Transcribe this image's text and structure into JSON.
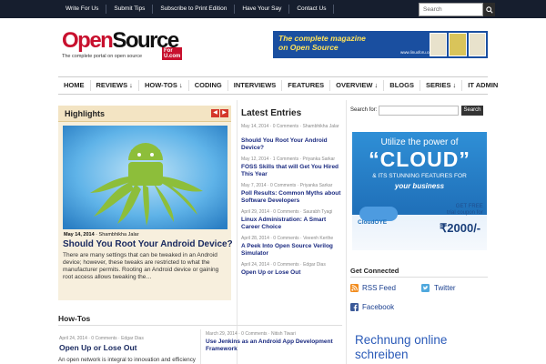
{
  "topnav": [
    "Write For Us",
    "Submit Tips",
    "Subscribe to Print Edition",
    "Have Your Say",
    "Contact Us"
  ],
  "search_top": {
    "placeholder": "Search"
  },
  "logo": {
    "open": "Open",
    "source": "Source",
    "foru": "For U.com",
    "tagline": "The complete portal on open source"
  },
  "banner": {
    "line1": "The complete magazine",
    "line2": "on Open Source",
    "url": "www.linuxforu.com"
  },
  "mainnav": [
    "HOME",
    "REVIEWS ↓",
    "HOW-TOS ↓",
    "CODING",
    "INTERVIEWS",
    "FEATURES",
    "OVERVIEW ↓",
    "BLOGS",
    "SERIES ↓",
    "IT ADMIN"
  ],
  "highlights": {
    "title": "Highlights",
    "date": "May 14, 2014",
    "author": "Shambhikha Jalar",
    "headline": "Should You Root Your Android Device?",
    "excerpt": "There are many settings that can be tweaked in an Android device; however, these tweaks are restricted to what the manufacturer permits. Rooting an Android device or gaining root access allows tweaking the…"
  },
  "latest": {
    "title": "Latest Entries",
    "items": [
      {
        "meta": "May 14, 2014 · 0 Comments · Shambhikha Jalar",
        "title": "Should You Root Your Android Device?"
      },
      {
        "meta": "May 12, 2014 · 1 Comments · Priyanka Sarkar",
        "title": "FOSS Skills that will Get You Hired This Year"
      },
      {
        "meta": "May 7, 2014 · 0 Comments · Priyanka Sarkar",
        "title": "Poll Results: Common Myths about Software Developers"
      },
      {
        "meta": "April 29, 2014 · 0 Comments · Saurabh Tyagi",
        "title": "Linux Administration: A Smart Career Choice"
      },
      {
        "meta": "April 28, 2014 · 0 Comments · Veeenh Kerthe",
        "title": "A Peek Into Open Source Verilog Simulator"
      },
      {
        "meta": "April 24, 2014 · 0 Comments · Edgar Dias",
        "title": "Open Up or Lose Out"
      }
    ]
  },
  "sidebar_search": {
    "label": "Search for:",
    "button": "Search"
  },
  "cloud_ad": {
    "line1": "Utilize the power of",
    "line2": "“CLOUD”",
    "line3": "& ITS STUNNING FEATURES FOR",
    "line4": "your business",
    "brand": "CloudOYE",
    "free1": "GET FREE",
    "free2": "trial coupon for",
    "price": "₹2000/-"
  },
  "get_connected": {
    "title": "Get Connected",
    "rss": "RSS Feed",
    "twitter": "Twitter",
    "facebook": "Facebook"
  },
  "rechnung": {
    "line1": "Rechnung online",
    "line2": "schreiben"
  },
  "howtos": {
    "title": "How-Tos",
    "left_meta": "April 24, 2014 · 0 Comments · Edgar Dias",
    "left_title": "Open Up or Lose Out",
    "left_excerpt": "An open network is integral to innovation and efficiency",
    "right_meta": "March 29, 2014 · 0 Comments · Nitish Tiwari",
    "right_title": "Use Jenkins as an Android App Development Framework"
  },
  "colors": {
    "topbar": "#161e2e",
    "accent_red": "#c8102e",
    "link_blue": "#1a2a80",
    "highlight_bg": "#f7efdd"
  }
}
